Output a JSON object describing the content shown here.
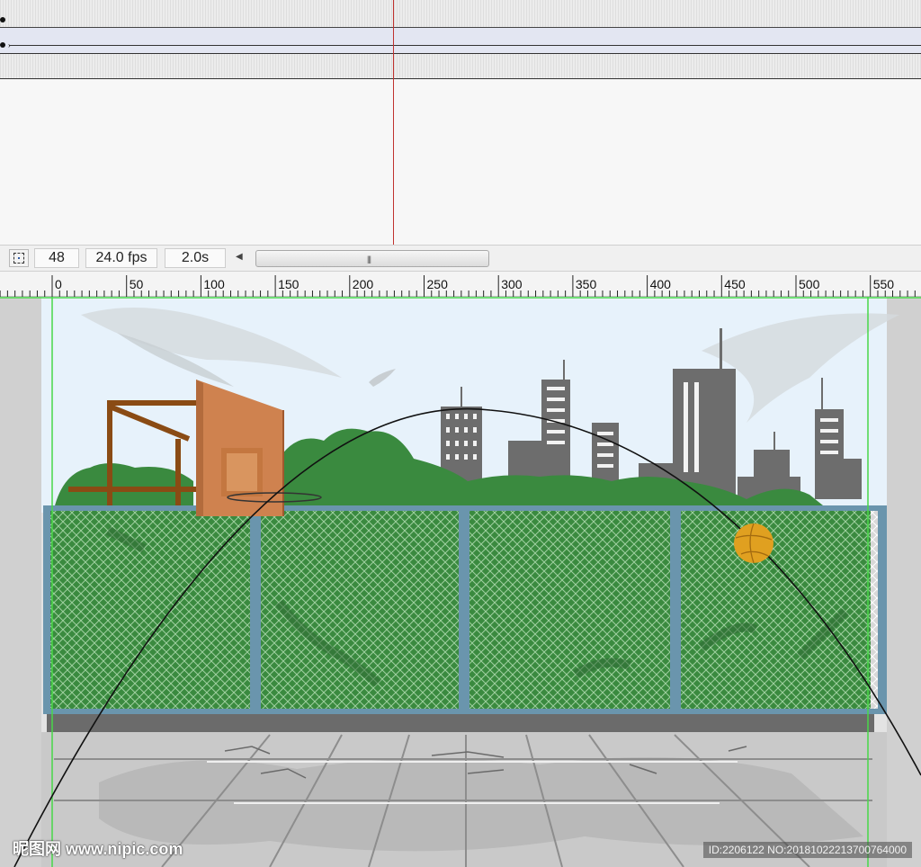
{
  "timeline": {
    "current_frame": "48",
    "frame_rate": "24.0 fps",
    "elapsed_time": "2.0s"
  },
  "ruler": {
    "labels": [
      "0",
      "50",
      "100",
      "150",
      "200",
      "250",
      "300",
      "350",
      "400",
      "450",
      "500",
      "550"
    ]
  },
  "stage": {
    "scene": "basketball court",
    "ball_color": "#e0a020",
    "fence_color": "#3a8a3f"
  },
  "watermark": {
    "left": "昵图网 www.nipic.com",
    "right": "ID:2206122 NO:20181022213700764000"
  },
  "icons": {
    "center_frame": "center-frame-icon",
    "scroll_left": "scroll-left-arrow-icon",
    "scroll_grip": "scroll-grip-icon"
  }
}
